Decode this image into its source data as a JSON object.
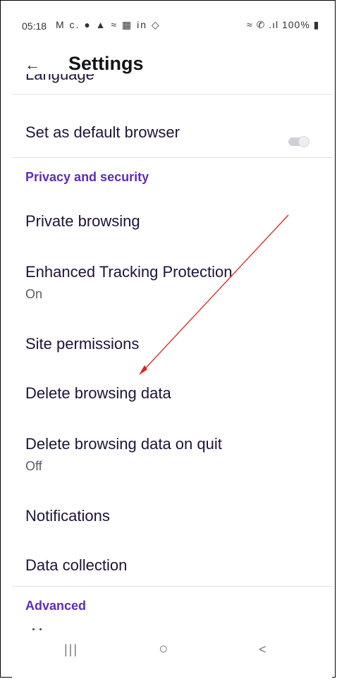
{
  "status_bar": {
    "time": "05:18",
    "left_icons": "M c. ● ▲ ≈ ▦ in ◇",
    "right_icons": "≈ ✆ .ıl 100% ▮"
  },
  "app_bar": {
    "back_icon": "←",
    "title": "Settings"
  },
  "list": {
    "language_partial": "Language",
    "default_browser": {
      "label": "Set as default browser",
      "toggle_on": false
    },
    "privacy_section": "Privacy and security",
    "private_browsing": "Private browsing",
    "tracking_protection": {
      "label": "Enhanced Tracking Protection",
      "value": "On"
    },
    "site_permissions": "Site permissions",
    "delete_browsing_data": "Delete browsing data",
    "delete_on_quit": {
      "label": "Delete browsing data on quit",
      "value": "Off"
    },
    "notifications": "Notifications",
    "data_collection": "Data collection",
    "advanced_section": "Advanced"
  },
  "nav_bar": {
    "recents_icon": "|||",
    "home_icon": "○",
    "back_icon": "<"
  },
  "colors": {
    "accent": "#5b2dbf",
    "annotation_arrow": "#e0201c"
  }
}
